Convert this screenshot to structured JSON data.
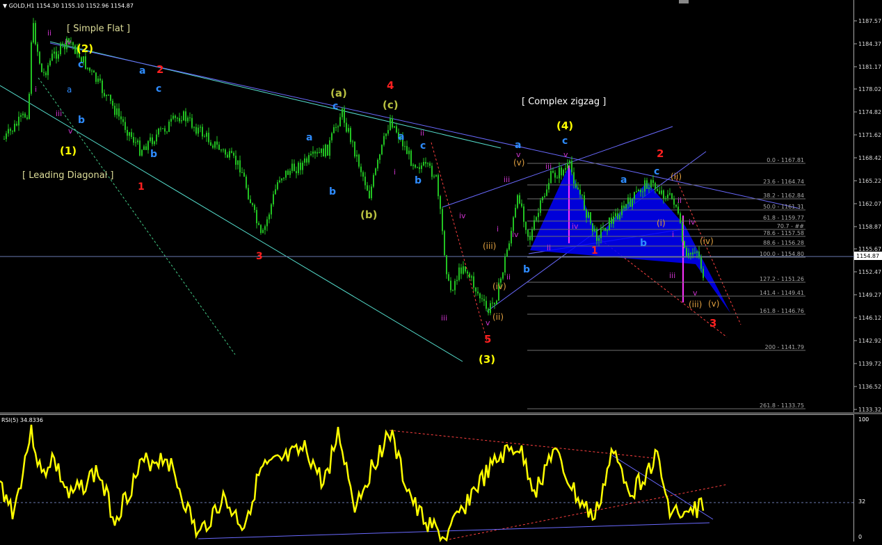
{
  "header": {
    "symbol": "GOLD,H1",
    "ohlc": "1154.30 1155.10 1152.96 1154.87",
    "dropdown_icon": "triangle-down-icon"
  },
  "rsi_header": "RSI(5) 34.8336",
  "price_axis": [
    "1187.57",
    "1184.37",
    "1181.17",
    "1178.02",
    "1174.82",
    "1171.62",
    "1168.42",
    "1165.22",
    "1162.07",
    "1158.87",
    "1155.67",
    "1152.47",
    "1149.27",
    "1146.12",
    "1142.92",
    "1139.72",
    "1136.52",
    "1133.32"
  ],
  "current_price": "1154.87",
  "rsi_axis": [
    "100",
    "32",
    "0"
  ],
  "fib_levels": [
    "0.0 - 1167.81",
    "23.6 - 1164.74",
    "38.2 - 1162.84",
    "50.0 - 1161.31",
    "61.8 - 1159.77",
    "70.7 - ##",
    "78.6 - 1157.58",
    "88.6 - 1156.28",
    "100.0 - 1154.80",
    "127.2 - 1151.26",
    "141.4 - 1149.41",
    "161.8 - 1146.76",
    "200 - 1141.79",
    "261.8 - 1133.75"
  ],
  "annotations": {
    "simple_flat": "[ Simple Flat ]",
    "leading_diagonal": "[ Leading Diagonal ]",
    "complex_zigzag": "[ Complex zigzag ]"
  },
  "wave_labels": {
    "w1_yellow": "(1)",
    "w2_yellow": "(2)",
    "w3_yellow": "(3)",
    "w4_yellow": "(4)",
    "red1a": "1",
    "red2a": "2",
    "red3a": "3",
    "red4": "4",
    "red5": "5",
    "red1b": "1",
    "red2b": "2",
    "red3b": "3",
    "a": "a",
    "b": "b",
    "c": "c",
    "olive_a": "(a)",
    "olive_b": "(b)",
    "olive_c": "(c)",
    "i": "i",
    "ii": "ii",
    "iii": "iii",
    "iv": "iv",
    "v": "v",
    "p_ii": "(ii)",
    "p_iii": "(iii)",
    "p_iv": "(iv)",
    "p_v": "(v)",
    "p_i": "(i)"
  },
  "colors": {
    "candle": "#22c322",
    "rsi": "#ffff00",
    "yellow_label": "#ffff00",
    "red_label": "#ff2020",
    "blue_label": "#2e8cff",
    "magenta_label": "#cc33cc",
    "olive_label": "#b8c040",
    "orange_label": "#e0a040",
    "harmonic": "#0000ff"
  }
}
